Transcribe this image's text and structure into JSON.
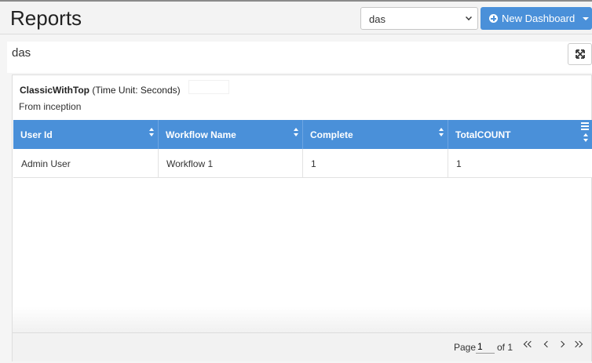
{
  "header": {
    "title": "Reports",
    "dashboard_select": {
      "value": "das"
    },
    "new_dashboard_label": "New Dashboard"
  },
  "dashboard": {
    "name": "das"
  },
  "widget": {
    "title_bold": "ClassicWithTop",
    "title_suffix": "(Time Unit: Seconds)",
    "subtitle": "From inception",
    "columns": [
      "User Id",
      "Workflow Name",
      "Complete",
      "TotalCOUNT"
    ],
    "rows": [
      [
        "Admin User",
        "Workflow 1",
        "1",
        "1"
      ]
    ],
    "pager": {
      "page_label": "Page",
      "page_value": "1",
      "of_label": "of 1"
    }
  },
  "colors": {
    "accent": "#4a90d9",
    "header_bg": "#f3f3f3"
  },
  "icons": [
    "plus-circle-icon",
    "caret-down-icon",
    "expand-icon",
    "sort-icon",
    "column-menu-icon",
    "first-page-icon",
    "prev-page-icon",
    "next-page-icon",
    "last-page-icon"
  ]
}
